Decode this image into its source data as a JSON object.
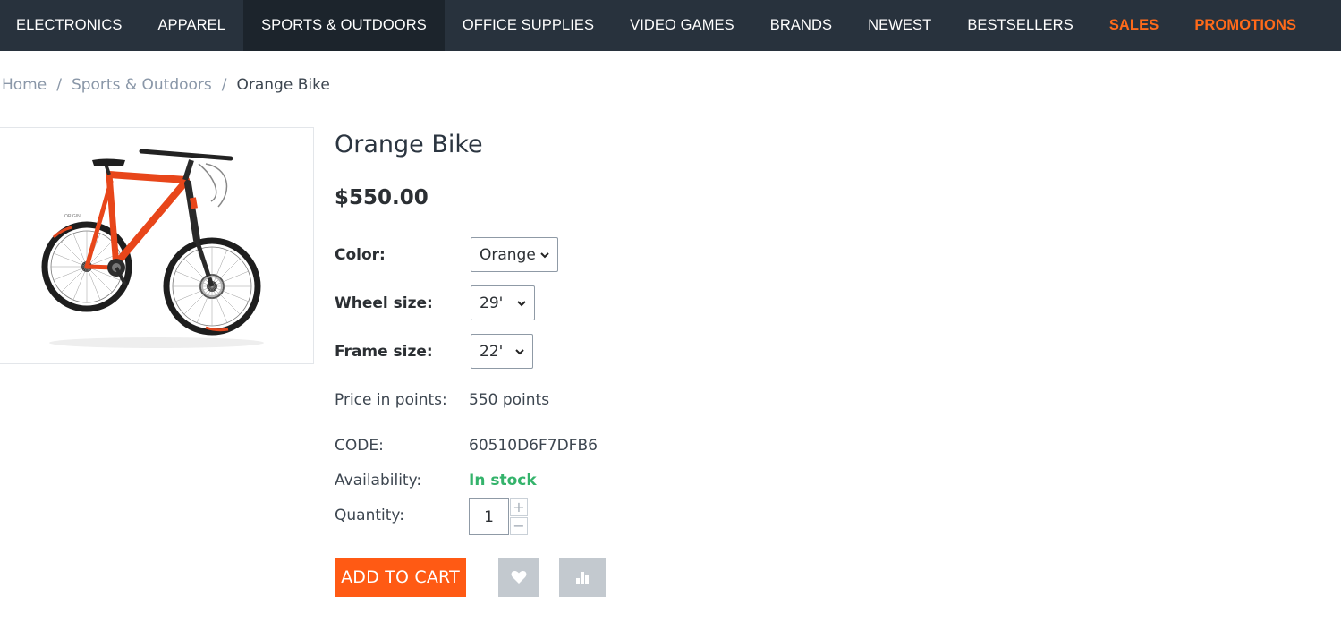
{
  "nav": {
    "items": [
      {
        "label": "ELECTRONICS"
      },
      {
        "label": "APPAREL"
      },
      {
        "label": "SPORTS & OUTDOORS"
      },
      {
        "label": "OFFICE SUPPLIES"
      },
      {
        "label": "VIDEO GAMES"
      },
      {
        "label": "BRANDS"
      },
      {
        "label": "NEWEST"
      },
      {
        "label": "BESTSELLERS"
      },
      {
        "label": "SALES"
      },
      {
        "label": "PROMOTIONS"
      }
    ],
    "active": "SPORTS & OUTDOORS",
    "highlight_color": "#ff6a1a",
    "bar_color": "#28323d"
  },
  "breadcrumb": {
    "home": "Home",
    "category": "Sports & Outdoors",
    "current": "Orange Bike",
    "separator": "/"
  },
  "product": {
    "title": "Orange Bike",
    "price": "$550.00",
    "image_icon": "bike-photo",
    "options": {
      "color": {
        "label": "Color:",
        "value": "Orange"
      },
      "wheel_size": {
        "label": "Wheel size:",
        "value": "29'"
      },
      "frame_size": {
        "label": "Frame size:",
        "value": "22'"
      }
    },
    "points": {
      "label": "Price in points:",
      "value": "550 points"
    },
    "code": {
      "label": "CODE:",
      "value": "60510D6F7DFB6"
    },
    "availability": {
      "label": "Availability:",
      "value": "In stock",
      "color": "#34b36b"
    },
    "quantity": {
      "label": "Quantity:",
      "value": "1",
      "increase": "+",
      "decrease": "−"
    }
  },
  "actions": {
    "add_to_cart": "ADD TO CART",
    "add_to_cart_color": "#ff5a14",
    "wishlist_icon": "heart-icon",
    "compare_icon": "bar-chart-icon"
  }
}
